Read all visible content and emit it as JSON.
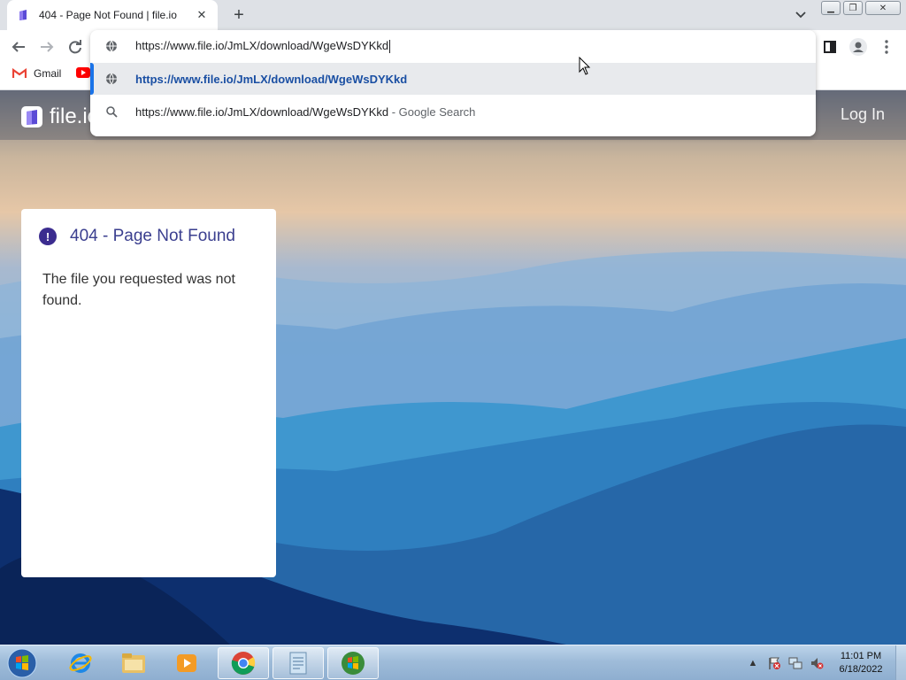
{
  "browser": {
    "tab": {
      "title": "404 - Page Not Found | file.io"
    },
    "new_tab_label": "+",
    "bookmarks": [
      {
        "label": "Gmail",
        "icon": "gmail-icon"
      },
      {
        "label": "",
        "icon": "youtube-icon"
      }
    ],
    "omnibox": {
      "input_value": "https://www.file.io/JmLX/download/WgeWsDYKkd",
      "suggestions": [
        {
          "text": "https://www.file.io/JmLX/download/WgeWsDYKkd",
          "suffix": "",
          "icon": "globe-icon",
          "selected": true
        },
        {
          "text": "https://www.file.io/JmLX/download/WgeWsDYKkd",
          "suffix": "- Google Search",
          "icon": "search-icon",
          "selected": false
        }
      ]
    }
  },
  "site": {
    "logo_text": "file.io",
    "login_label": "Log In"
  },
  "error_card": {
    "title": "404 - Page Not Found",
    "icon_glyph": "!",
    "message": "The file you requested was not found."
  },
  "taskbar": {
    "clock_time": "11:01 PM",
    "clock_date": "6/18/2022",
    "apps": [
      "internet-explorer",
      "file-explorer",
      "media-player",
      "chrome",
      "notepad",
      "windows-logo"
    ]
  },
  "colors": {
    "accent": "#1a73e8",
    "error_icon": "#3b2c8f",
    "card_title": "#3b3f8f"
  }
}
